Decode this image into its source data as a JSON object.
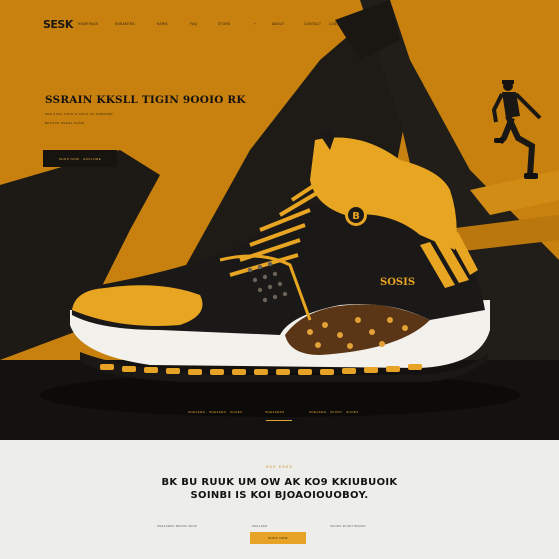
{
  "brand": {
    "logo": "SESK"
  },
  "nav": {
    "links": [
      "HOMEPAGE",
      "SNEAKERS",
      "NEWS",
      "FAQ",
      "STORE",
      "+",
      "ABOUT",
      "CONTACT",
      "LOGIN"
    ]
  },
  "hero": {
    "headline": "SSRAIN KKSLL TIGIN 9OOIO RK",
    "subline_1": "SKE KKSL TIGIN S SKKS OK SNEAKER",
    "subline_2": "BESTOK SNEAK SHOE",
    "cta_label": "SHOP NOW · EXPLORE",
    "shoe_badge": "B",
    "shoe_brand": "SOSIS",
    "footer_left": "SNEAKER · SNEAKER · SHOES",
    "footer_center": "SNEAKERS",
    "footer_right": "SNEAKER · SPORT · SHOES"
  },
  "section": {
    "eyebrow": "SKS KSKS",
    "title_line_1": "BK BU RUUK UM OW AK KO9 KKIUBUOIK",
    "title_line_2": "SOINBI IS KOI BJOAOIOUOBOY.",
    "tiny_left": "SNEAKERS BRAND SHOP",
    "tiny_center": "SNEAKER",
    "tiny_right": "SHOES SPORT BRAND",
    "cta_label": "SHOP NOW"
  },
  "colors": {
    "hero_orange": "#c9820f",
    "dark": "#17140f",
    "accent_yellow": "#e6a325",
    "page_bg": "#ededea"
  }
}
